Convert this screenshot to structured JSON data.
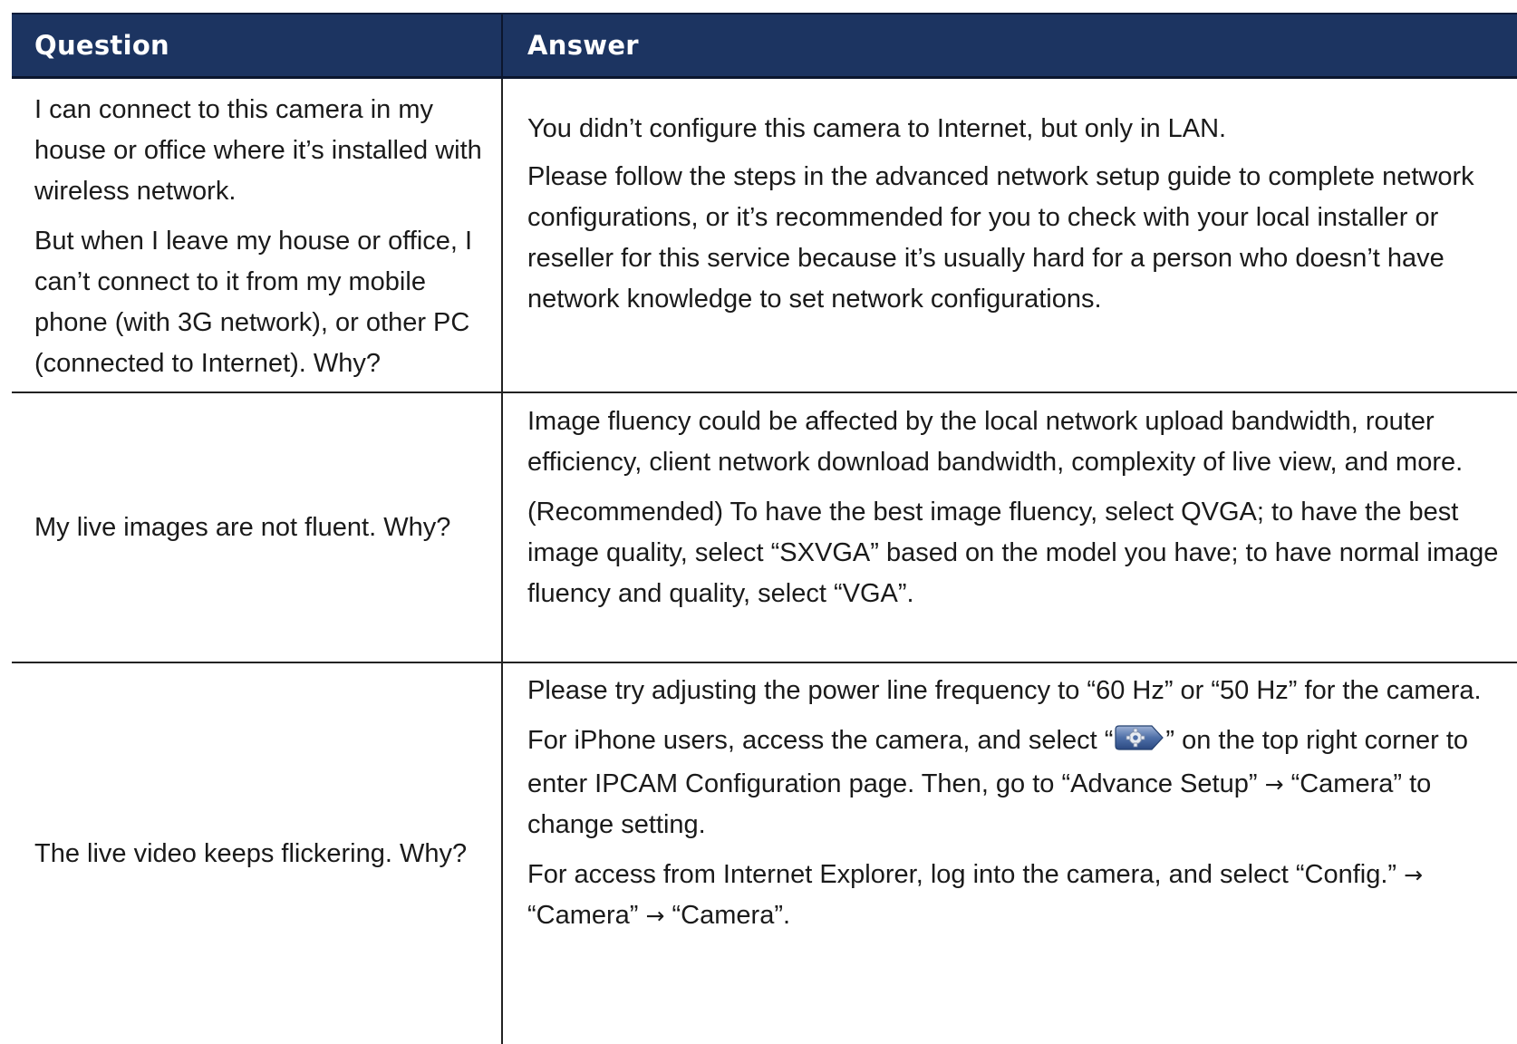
{
  "table": {
    "headers": {
      "question": "Question",
      "answer": "Answer"
    },
    "rows": [
      {
        "question": [
          "I can connect to this camera in my house or office where it’s installed with wireless network.",
          "But when I leave my house or office, I can’t connect to it from my mobile phone (with 3G network), or other PC (connected to Internet). Why?"
        ],
        "answer": [
          "You didn’t configure this camera to Internet, but only in LAN.",
          "Please follow the steps in the advanced network setup guide to complete network configurations, or it’s recommended for you to check with your local installer or reseller for this service because it’s usually hard for a person who doesn’t have network knowledge to set network configurations."
        ]
      },
      {
        "question": [
          "My live images are not fluent. Why?"
        ],
        "answer": [
          "Image fluency could be affected by the local network upload bandwidth, router efficiency, client network download bandwidth, complexity of live view, and more.",
          "(Recommended) To have the best image fluency, select QVGA; to have the best image quality, select “SXVGA” based on the model you have; to have normal image fluency and quality, select “VGA”."
        ]
      },
      {
        "question": [
          "The live video keeps flickering. Why?"
        ],
        "answer": {
          "p1": "Please try adjusting the power line frequency to “60 Hz” or “50 Hz” for the camera.",
          "p2_before": "For iPhone users, access the camera, and select “",
          "p2_icon": "gear-settings-icon",
          "p2_mid": "” on the top right corner to enter IPCAM Configuration page. Then, go to “Advance Setup” ",
          "p2_arrow": "→",
          "p2_after": " “Camera” to change setting.",
          "p3_a": "For access from Internet Explorer, log into the camera, and select “Config.” ",
          "p3_arrow1": "→",
          "p3_b": " “Camera” ",
          "p3_arrow2": "→",
          "p3_c": " “Camera”."
        }
      }
    ]
  },
  "colors": {
    "header_bg": "#1c3461",
    "header_text": "#ffffff",
    "body_text": "#1a1a1a",
    "rule": "#222222"
  }
}
